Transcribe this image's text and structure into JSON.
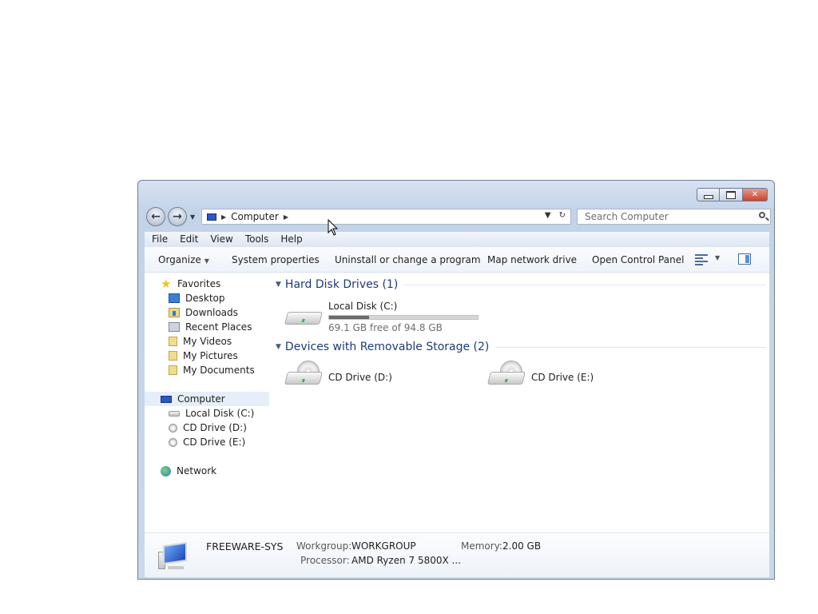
{
  "window": {
    "address": {
      "location": "Computer"
    },
    "search": {
      "placeholder": "Search Computer"
    }
  },
  "menubar": [
    "File",
    "Edit",
    "View",
    "Tools",
    "Help"
  ],
  "toolbar": {
    "organize": "Organize",
    "system_properties": "System properties",
    "uninstall": "Uninstall or change a program",
    "map_network": "Map network drive",
    "control_panel": "Open Control Panel"
  },
  "navpane": {
    "favorites": "Favorites",
    "fav_items": [
      "Desktop",
      "Downloads",
      "Recent Places",
      "My Videos",
      "My Pictures",
      "My Documents"
    ],
    "computer": "Computer",
    "computer_items": [
      "Local Disk (C:)",
      "CD Drive (D:)",
      "CD Drive (E:)"
    ],
    "network": "Network"
  },
  "groups": {
    "hard_disks": "Hard Disk Drives (1)",
    "removable": "Devices with Removable Storage (2)"
  },
  "drives": {
    "local_c": {
      "name": "Local Disk (C:)",
      "free_text": "69.1 GB free of 94.8 GB",
      "used_fraction": 0.27
    },
    "cd_d": {
      "name": "CD Drive (D:)"
    },
    "cd_e": {
      "name": "CD Drive (E:)"
    }
  },
  "details": {
    "computer_name": "FREEWARE-SYS",
    "workgroup_label": "Workgroup:",
    "workgroup_value": "WORKGROUP",
    "memory_label": "Memory:",
    "memory_value": "2.00 GB",
    "processor_label": "Processor:",
    "processor_value": "AMD Ryzen 7 5800X ..."
  },
  "colors": {
    "window_frame": "#c3d3e8",
    "group_header": "#1e3a78",
    "close_button": "#c7452f",
    "selection": "#e5eef9"
  }
}
